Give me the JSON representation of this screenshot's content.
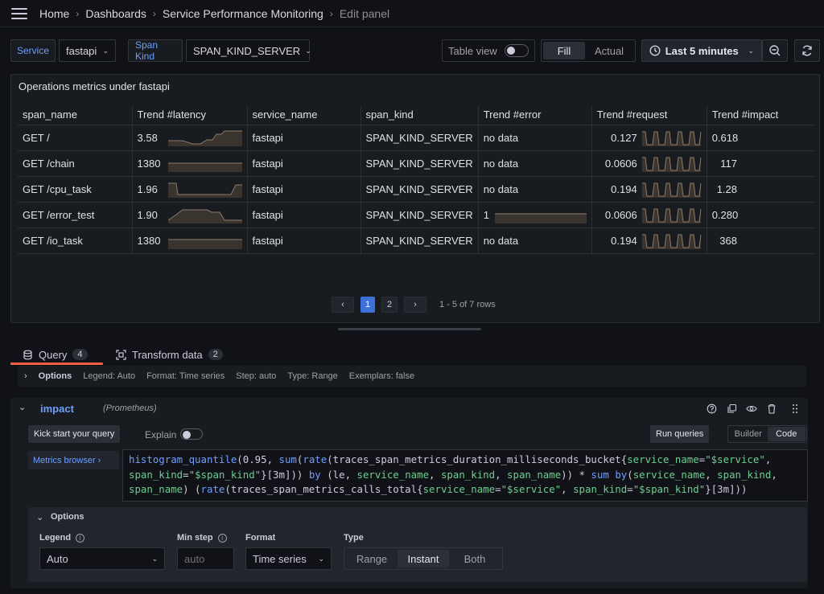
{
  "breadcrumbs": [
    "Home",
    "Dashboards",
    "Service Performance Monitoring",
    "Edit panel"
  ],
  "toolbar": {
    "service_label": "Service",
    "service_value": "fastapi",
    "span_kind_label": "Span Kind",
    "span_kind_value": "SPAN_KIND_SERVER",
    "table_view_label": "Table view",
    "fill_label": "Fill",
    "actual_label": "Actual",
    "time_range": "Last 5 minutes"
  },
  "panel": {
    "title": "Operations metrics under fastapi",
    "columns": [
      "span_name",
      "Trend #latency",
      "service_name",
      "span_kind",
      "Trend #error",
      "Trend #request",
      "Trend #impact"
    ],
    "rows": [
      {
        "span_name": "GET /",
        "latency": "3.58",
        "service_name": "fastapi",
        "span_kind": "SPAN_KIND_SERVER",
        "error": "no data",
        "request": "0.127",
        "impact": "0.618"
      },
      {
        "span_name": "GET /chain",
        "latency": "1380",
        "service_name": "fastapi",
        "span_kind": "SPAN_KIND_SERVER",
        "error": "no data",
        "request": "0.0606",
        "impact": "117"
      },
      {
        "span_name": "GET /cpu_task",
        "latency": "1.96",
        "service_name": "fastapi",
        "span_kind": "SPAN_KIND_SERVER",
        "error": "no data",
        "request": "0.194",
        "impact": "1.28"
      },
      {
        "span_name": "GET /error_test",
        "latency": "1.90",
        "service_name": "fastapi",
        "span_kind": "SPAN_KIND_SERVER",
        "error": "1",
        "request": "0.0606",
        "impact": "0.280"
      },
      {
        "span_name": "GET /io_task",
        "latency": "1380",
        "service_name": "fastapi",
        "span_kind": "SPAN_KIND_SERVER",
        "error": "no data",
        "request": "0.194",
        "impact": "368"
      }
    ],
    "pagination": {
      "prev": "‹",
      "pages": [
        "1",
        "2"
      ],
      "next": "›",
      "info": "1 - 5 of 7 rows"
    }
  },
  "tabs": {
    "query_label": "Query",
    "query_count": "4",
    "transform_label": "Transform data",
    "transform_count": "2"
  },
  "options_row": {
    "label": "Options",
    "legend": "Legend: Auto",
    "format": "Format: Time series",
    "step": "Step: auto",
    "type": "Type: Range",
    "exemplars": "Exemplars: false"
  },
  "query": {
    "name": "impact",
    "datasource": "(Prometheus)",
    "kick_start": "Kick start your query",
    "explain": "Explain",
    "run_queries": "Run queries",
    "builder": "Builder",
    "code": "Code",
    "metrics_browser": "Metrics browser ›",
    "options_label": "Options",
    "legend_label": "Legend",
    "legend_value": "Auto",
    "min_step_label": "Min step",
    "min_step_placeholder": "auto",
    "format_label": "Format",
    "format_value": "Time series",
    "type_label": "Type",
    "type_options": [
      "Range",
      "Instant",
      "Both"
    ]
  },
  "colors": {
    "accent": "#3d71d9",
    "tab_underline": "#f55f3e",
    "link": "#6e9fff",
    "string": "#6ccf8e"
  }
}
